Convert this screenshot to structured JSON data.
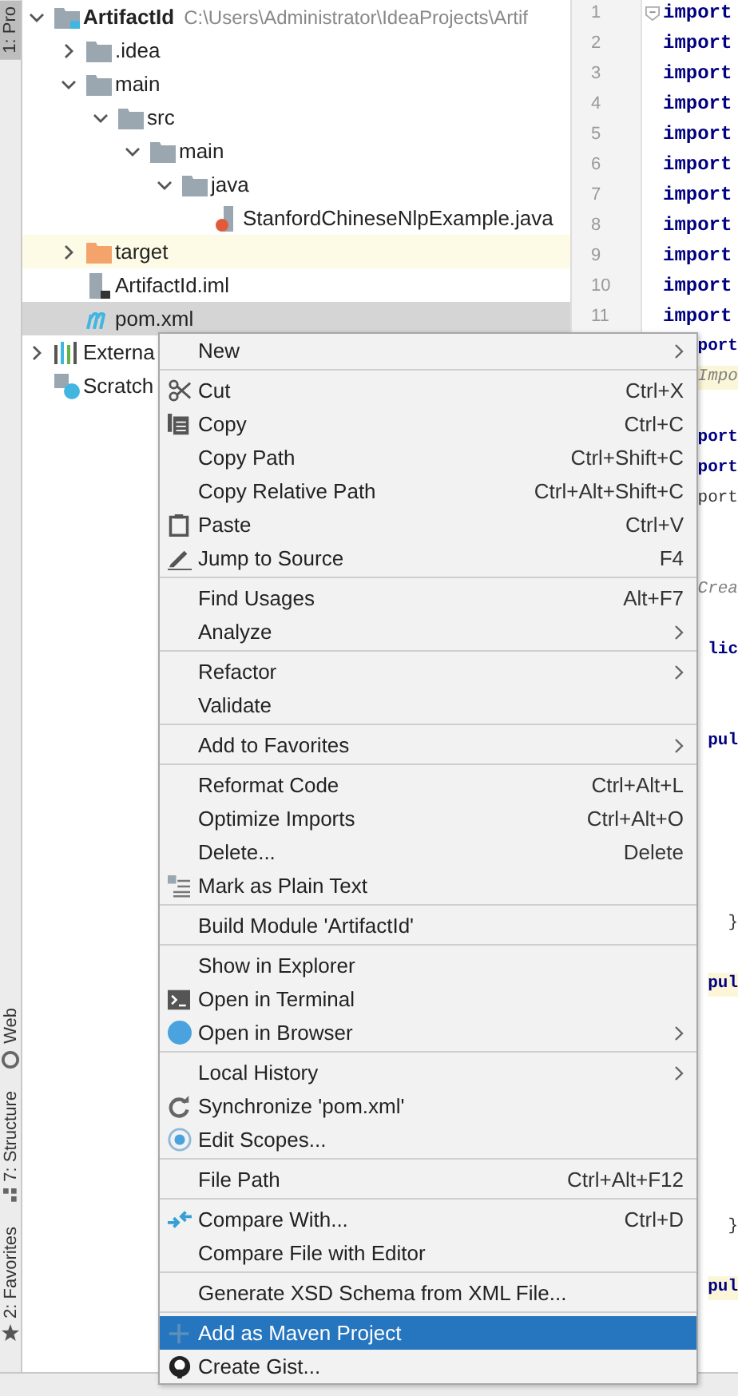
{
  "tool_strip": {
    "top_label": "1: Pro",
    "bottom_labels": [
      {
        "kind": "web",
        "label": "Web"
      },
      {
        "kind": "structure",
        "label": "7: Structure"
      },
      {
        "kind": "favorites",
        "label": "2: Favorites"
      }
    ]
  },
  "project_tree": [
    {
      "kind": "module",
      "label": "ArtifactId",
      "hint": "C:\\Users\\Administrator\\IdeaProjects\\Artif",
      "expanded": true,
      "selected": false,
      "children": [
        {
          "kind": "folder",
          "label": ".idea",
          "expanded": false,
          "selected": false
        },
        {
          "kind": "folder",
          "label": "main",
          "expanded": true,
          "selected": false,
          "children": [
            {
              "kind": "folder",
              "label": "src",
              "expanded": true,
              "selected": false,
              "children": [
                {
                  "kind": "folder",
                  "label": "main",
                  "expanded": true,
                  "selected": false,
                  "children": [
                    {
                      "kind": "folder",
                      "label": "java",
                      "expanded": true,
                      "selected": false,
                      "children": [
                        {
                          "kind": "java",
                          "label": "StanfordChineseNlpExample.java",
                          "selected": false
                        }
                      ]
                    }
                  ]
                }
              ]
            }
          ]
        },
        {
          "kind": "excluded",
          "label": "target",
          "expanded": false,
          "selected": false,
          "highlighted": true
        },
        {
          "kind": "iml",
          "label": "ArtifactId.iml",
          "selected": false
        },
        {
          "kind": "maven",
          "label": "pom.xml",
          "selected": true
        }
      ]
    },
    {
      "kind": "libraries",
      "label": "Externa",
      "expanded": false,
      "selected": false
    },
    {
      "kind": "scratches",
      "label": "Scratch",
      "selected": false
    }
  ],
  "editor_lines": [
    {
      "number": "1",
      "kind": "keyword",
      "text": "import",
      "fold": true
    },
    {
      "number": "2",
      "kind": "keyword",
      "text": "import"
    },
    {
      "number": "3",
      "kind": "keyword",
      "text": "import"
    },
    {
      "number": "4",
      "kind": "keyword",
      "text": "import"
    },
    {
      "number": "5",
      "kind": "keyword",
      "text": "import"
    },
    {
      "number": "6",
      "kind": "keyword",
      "text": "import"
    },
    {
      "number": "7",
      "kind": "keyword",
      "text": "import"
    },
    {
      "number": "8",
      "kind": "keyword",
      "text": "import"
    },
    {
      "number": "9",
      "kind": "keyword",
      "text": "import"
    },
    {
      "number": "10",
      "kind": "keyword",
      "text": "import"
    },
    {
      "number": "11",
      "kind": "keyword",
      "text": "import"
    },
    {
      "kind": "keyword",
      "text": "port"
    },
    {
      "kind": "comment",
      "text": "Impo",
      "highlighted": true
    },
    {
      "kind": "blank"
    },
    {
      "kind": "keyword",
      "text": "port"
    },
    {
      "kind": "keyword",
      "text": "port"
    },
    {
      "kind": "plain",
      "text": "port"
    },
    {
      "kind": "blank"
    },
    {
      "kind": "blank"
    },
    {
      "kind": "comment",
      "text": "Crea"
    },
    {
      "kind": "blank"
    },
    {
      "kind": "keyword",
      "text": "lic"
    },
    {
      "kind": "blank"
    },
    {
      "kind": "blank"
    },
    {
      "kind": "keyword",
      "text": "pul"
    },
    {
      "kind": "blank"
    },
    {
      "kind": "blank"
    },
    {
      "kind": "blank"
    },
    {
      "kind": "blank"
    },
    {
      "kind": "blank"
    },
    {
      "kind": "plain",
      "text": "}"
    },
    {
      "kind": "blank"
    },
    {
      "kind": "keyword",
      "text": "pul",
      "highlighted": true
    },
    {
      "kind": "blank"
    },
    {
      "kind": "blank"
    },
    {
      "kind": "blank"
    },
    {
      "kind": "blank"
    },
    {
      "kind": "blank"
    },
    {
      "kind": "blank"
    },
    {
      "kind": "blank"
    },
    {
      "kind": "plain",
      "text": "}"
    },
    {
      "kind": "blank"
    },
    {
      "kind": "keyword",
      "text": "pul",
      "highlighted": true
    }
  ],
  "context_menu": {
    "groups": [
      [
        {
          "kind": "plain",
          "label": "New",
          "submenu": true,
          "selected": false
        }
      ],
      [
        {
          "kind": "cut",
          "label": "Cut",
          "shortcut": "Ctrl+X",
          "selected": false
        },
        {
          "kind": "copy",
          "label": "Copy",
          "shortcut": "Ctrl+C",
          "selected": false
        },
        {
          "kind": "plain",
          "label": "Copy Path",
          "shortcut": "Ctrl+Shift+C",
          "selected": false
        },
        {
          "kind": "plain",
          "label": "Copy Relative Path",
          "shortcut": "Ctrl+Alt+Shift+C",
          "selected": false
        },
        {
          "kind": "paste",
          "label": "Paste",
          "shortcut": "Ctrl+V",
          "selected": false
        },
        {
          "kind": "jump",
          "label": "Jump to Source",
          "shortcut": "F4",
          "selected": false
        }
      ],
      [
        {
          "kind": "plain",
          "label": "Find Usages",
          "shortcut": "Alt+F7",
          "selected": false
        },
        {
          "kind": "plain",
          "label": "Analyze",
          "submenu": true,
          "selected": false
        }
      ],
      [
        {
          "kind": "plain",
          "label": "Refactor",
          "submenu": true,
          "selected": false
        },
        {
          "kind": "plain",
          "label": "Validate",
          "selected": false
        }
      ],
      [
        {
          "kind": "plain",
          "label": "Add to Favorites",
          "submenu": true,
          "selected": false
        }
      ],
      [
        {
          "kind": "plain",
          "label": "Reformat Code",
          "shortcut": "Ctrl+Alt+L",
          "selected": false
        },
        {
          "kind": "plain",
          "label": "Optimize Imports",
          "shortcut": "Ctrl+Alt+O",
          "selected": false
        },
        {
          "kind": "plain",
          "label": "Delete...",
          "shortcut": "Delete",
          "selected": false
        },
        {
          "kind": "plaintext",
          "label": "Mark as Plain Text",
          "selected": false
        }
      ],
      [
        {
          "kind": "plain",
          "label": "Build Module 'ArtifactId'",
          "selected": false
        }
      ],
      [
        {
          "kind": "plain",
          "label": "Show in Explorer",
          "selected": false
        },
        {
          "kind": "terminal",
          "label": "Open in Terminal",
          "selected": false
        },
        {
          "kind": "browser",
          "label": "Open in Browser",
          "submenu": true,
          "selected": false
        }
      ],
      [
        {
          "kind": "plain",
          "label": "Local History",
          "submenu": true,
          "selected": false
        },
        {
          "kind": "sync",
          "label": "Synchronize 'pom.xml'",
          "selected": false
        },
        {
          "kind": "scopes",
          "label": "Edit Scopes...",
          "selected": false
        }
      ],
      [
        {
          "kind": "plain",
          "label": "File Path",
          "shortcut": "Ctrl+Alt+F12",
          "selected": false
        }
      ],
      [
        {
          "kind": "compare",
          "label": "Compare With...",
          "shortcut": "Ctrl+D",
          "selected": false
        },
        {
          "kind": "plain",
          "label": "Compare File with Editor",
          "selected": false
        }
      ],
      [
        {
          "kind": "plain",
          "label": "Generate XSD Schema from XML File...",
          "selected": false
        }
      ],
      [
        {
          "kind": "add",
          "label": "Add as Maven Project",
          "selected": true
        },
        {
          "kind": "gist",
          "label": "Create Gist...",
          "selected": false
        }
      ]
    ]
  }
}
